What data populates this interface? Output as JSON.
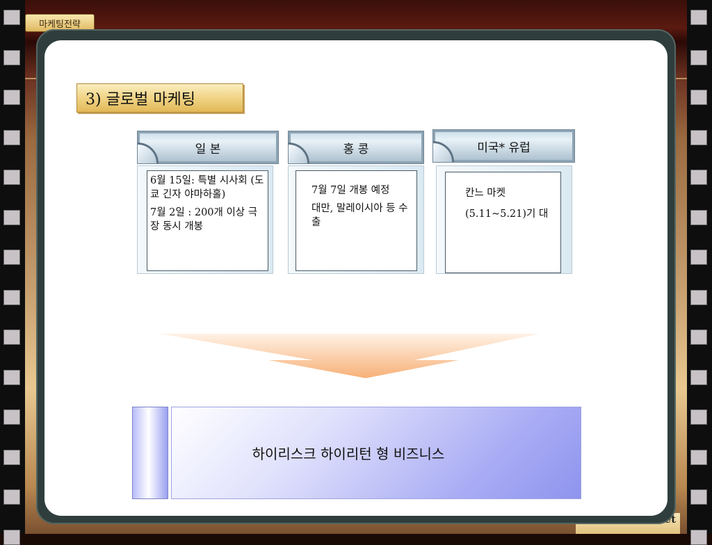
{
  "tag": "마케팅전략",
  "title": "3) 글로벌 마케팅",
  "columns": [
    {
      "header": "일 본",
      "lines": [
        "6월 15일: 특별 시사회 (도쿄 긴자 야마하홀)",
        "7월 2일 : 200개 이상 극장 동시 개봉"
      ]
    },
    {
      "header": "홍 콩",
      "lines": [
        "7월 7일 개봉 예정",
        "대만, 말레이시아 등 수출"
      ]
    },
    {
      "header": "미국* 유럽",
      "lines": [
        "칸느 마켓",
        "(5.11~5.21)기 대"
      ]
    }
  ],
  "banner": "하이리스크 하이리턴 형 비즈니스",
  "url": "s.net"
}
